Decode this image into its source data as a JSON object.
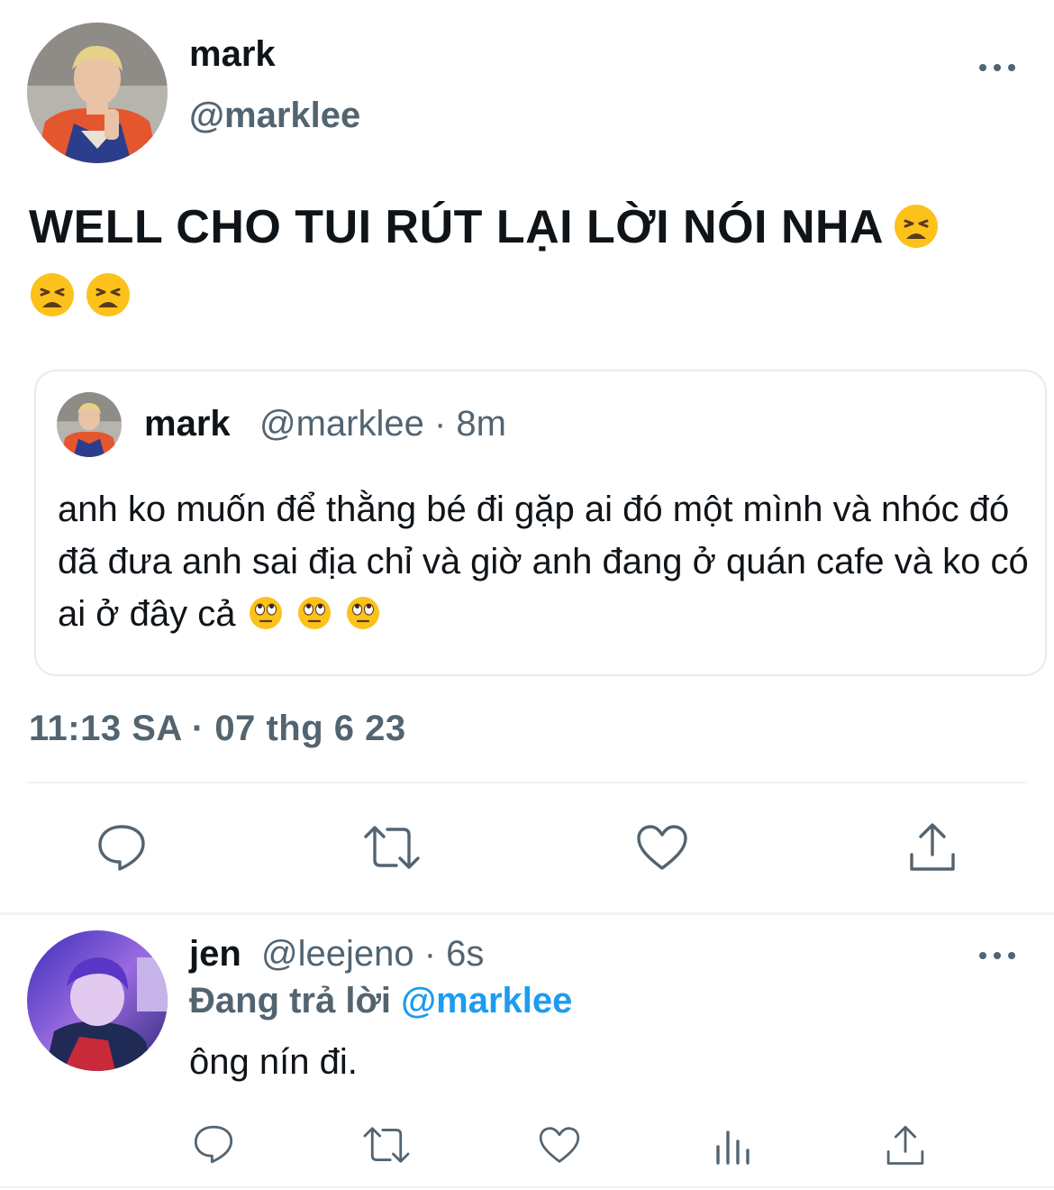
{
  "main_tweet": {
    "author_name": "mark",
    "author_handle": "@marklee",
    "text": "WELL CHO TUI RÚT LẠI LỜI NÓI NHA",
    "emoji_icon": "weary-face-icon",
    "timestamp": "11:13 SA · 07 thg 6 23"
  },
  "quoted_tweet": {
    "author_name": "mark",
    "meta": "@marklee · 8m",
    "text": "anh ko muốn để thằng bé đi gặp ai đó một mình và nhóc đó đã đưa anh sai địa chỉ và giờ anh đang ở quán cafe và ko có ai ở đây cả",
    "emoji_icon": "eye-roll-face-icon"
  },
  "reply": {
    "author_name": "jen",
    "meta": "@leejeno · 6s",
    "replying_prefix": "Đang trả lời",
    "replying_to": "@marklee",
    "text": "ông nín đi."
  },
  "colors": {
    "text": "#0f1419",
    "secondary": "#536471",
    "accent": "#1d9bf0",
    "border": "#e6ecf0"
  }
}
